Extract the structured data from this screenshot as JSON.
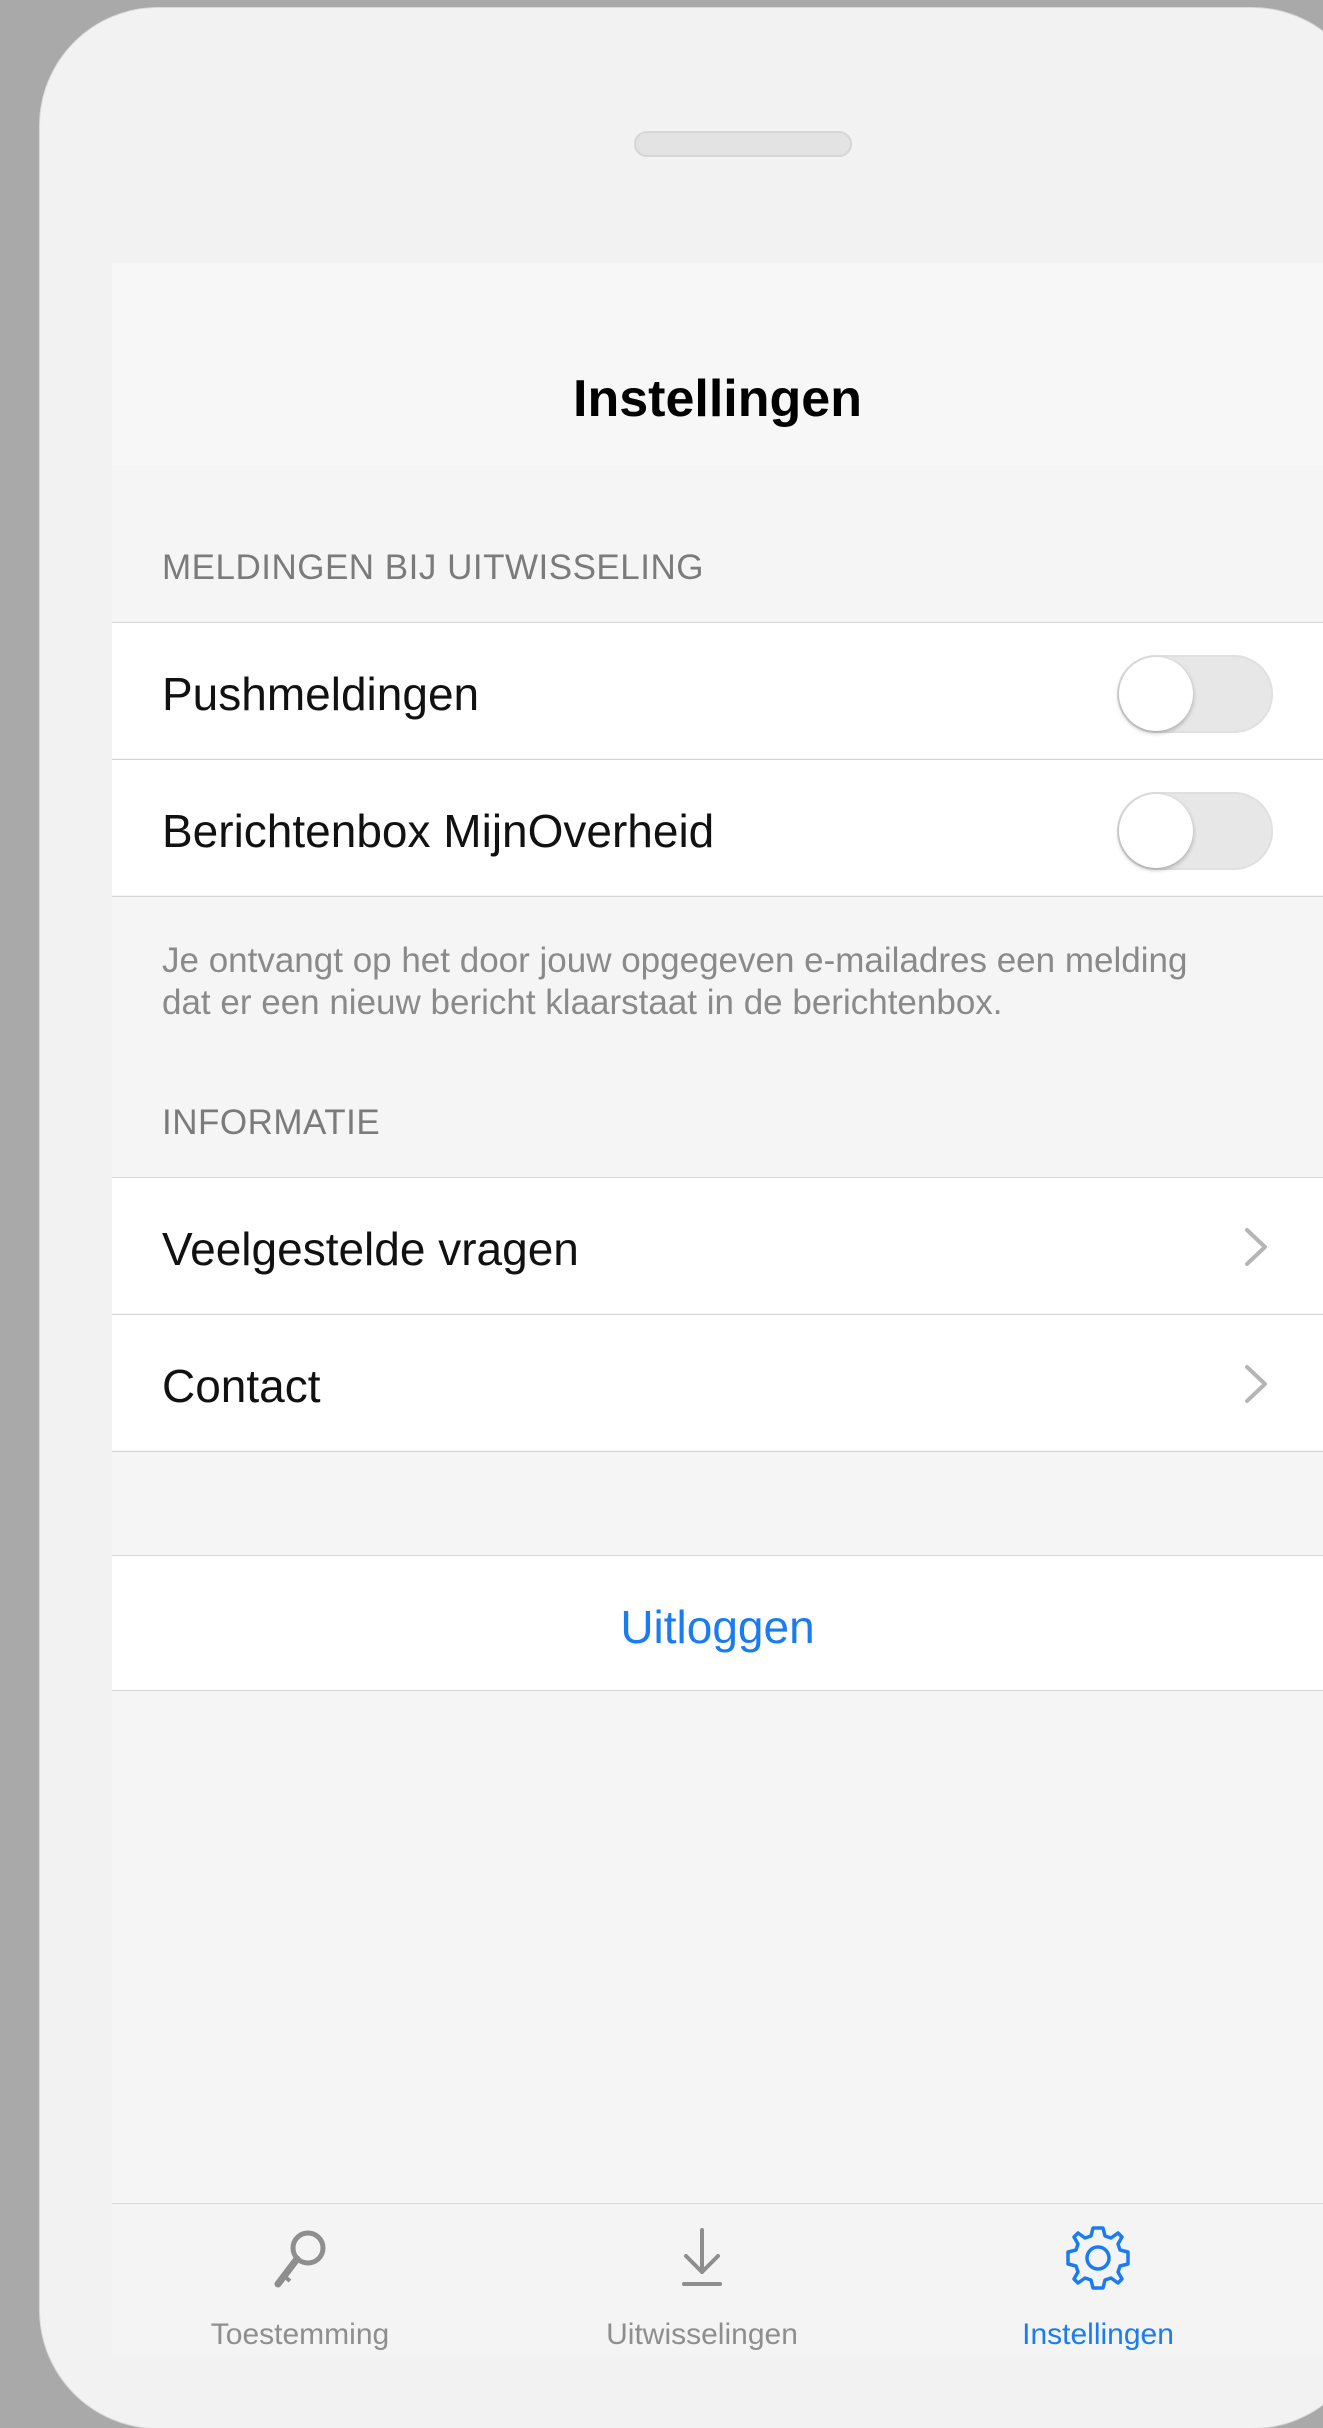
{
  "nav": {
    "title": "Instellingen"
  },
  "sections": {
    "meldingen": {
      "header": "MELDINGEN BIJ UITWISSELING",
      "items": [
        {
          "label": "Pushmeldingen",
          "toggle_on": false
        },
        {
          "label": "Berichtenbox MijnOverheid",
          "toggle_on": false
        }
      ],
      "footer": "Je ontvangt op het door jouw opgegeven e-mailadres een melding dat er een nieuw bericht klaarstaat in de berichtenbox."
    },
    "informatie": {
      "header": "INFORMATIE",
      "items": [
        {
          "label": "Veelgestelde vragen"
        },
        {
          "label": "Contact"
        }
      ]
    }
  },
  "logout": {
    "label": "Uitloggen"
  },
  "tabbar": {
    "tabs": [
      {
        "label": "Toestemming",
        "icon": "key-icon",
        "active": false
      },
      {
        "label": "Uitwisselingen",
        "icon": "download-icon",
        "active": false
      },
      {
        "label": "Instellingen",
        "icon": "gear-icon",
        "active": true
      }
    ]
  },
  "colors": {
    "accent": "#1a7cf0",
    "inactive_tab": "#8e8e8e",
    "section_header": "#7b7b7b"
  }
}
